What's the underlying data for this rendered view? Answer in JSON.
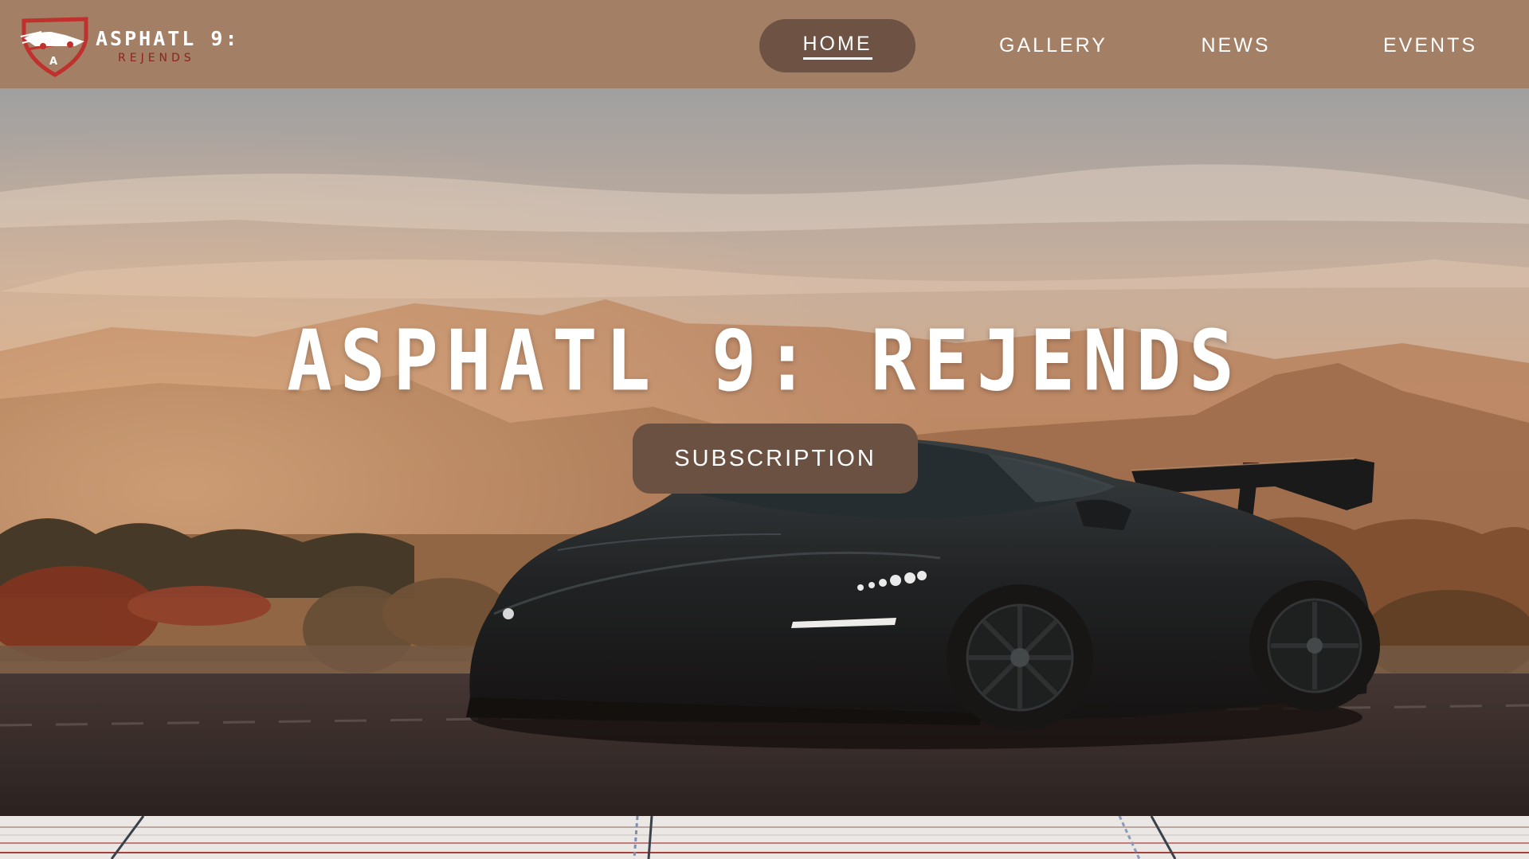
{
  "brand": {
    "title": "ASPHATL 9:",
    "subtitle": "REJENDS",
    "badge_letter": "A",
    "badge_icon": "car-shield-icon",
    "colors": {
      "badge_red": "#c0302c",
      "subtitle_red": "#8e2321"
    }
  },
  "nav": {
    "items": [
      {
        "label": "HOME",
        "active": true
      },
      {
        "label": "GALLERY",
        "active": false
      },
      {
        "label": "NEWS",
        "active": false
      },
      {
        "label": "EVENTS",
        "active": false
      }
    ]
  },
  "hero": {
    "title": "ASPHATL 9: REJENDS",
    "cta_label": "SUBSCRIPTION",
    "image": "black-supercar-at-sunset"
  },
  "colors": {
    "header_bg": "#a27f65",
    "nav_active_bg": "#6e5243",
    "cta_bg": "#6b5142",
    "text": "#ffffff"
  }
}
